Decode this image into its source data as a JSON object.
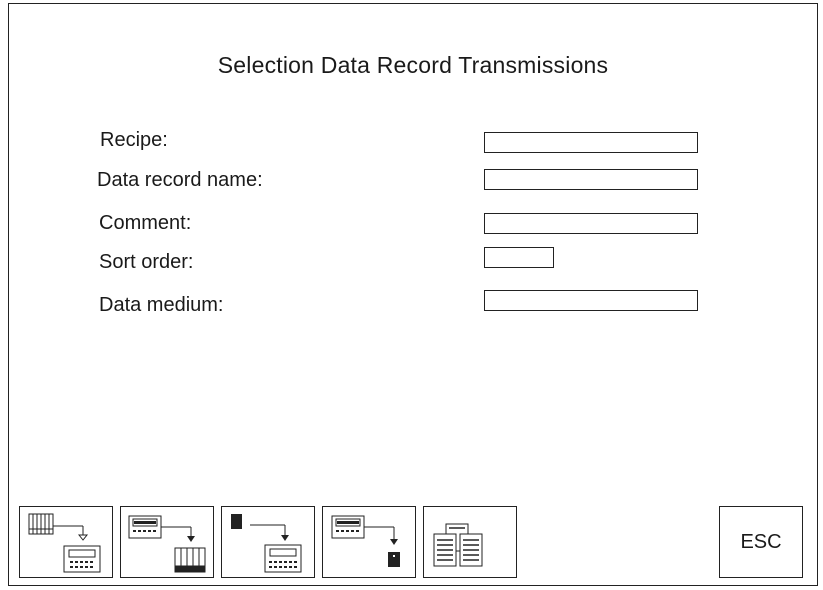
{
  "screen": {
    "title": "Selection Data Record Transmissions"
  },
  "form": {
    "recipe_label": "Recipe:",
    "record_name_label": "Data record name:",
    "comment_label": "Comment:",
    "sort_order_label": "Sort order:",
    "data_medium_label": "Data medium:",
    "recipe_value": "",
    "record_name_value": "",
    "comment_value": "",
    "sort_order_value": "",
    "data_medium_value": ""
  },
  "softkeys": {
    "icons": [
      "recipe-to-panel-transfer-icon",
      "panel-to-recipe-transfer-icon",
      "medium-to-panel-transfer-icon",
      "panel-to-medium-transfer-icon",
      "data-records-overview-icon"
    ],
    "esc_label": "ESC"
  }
}
